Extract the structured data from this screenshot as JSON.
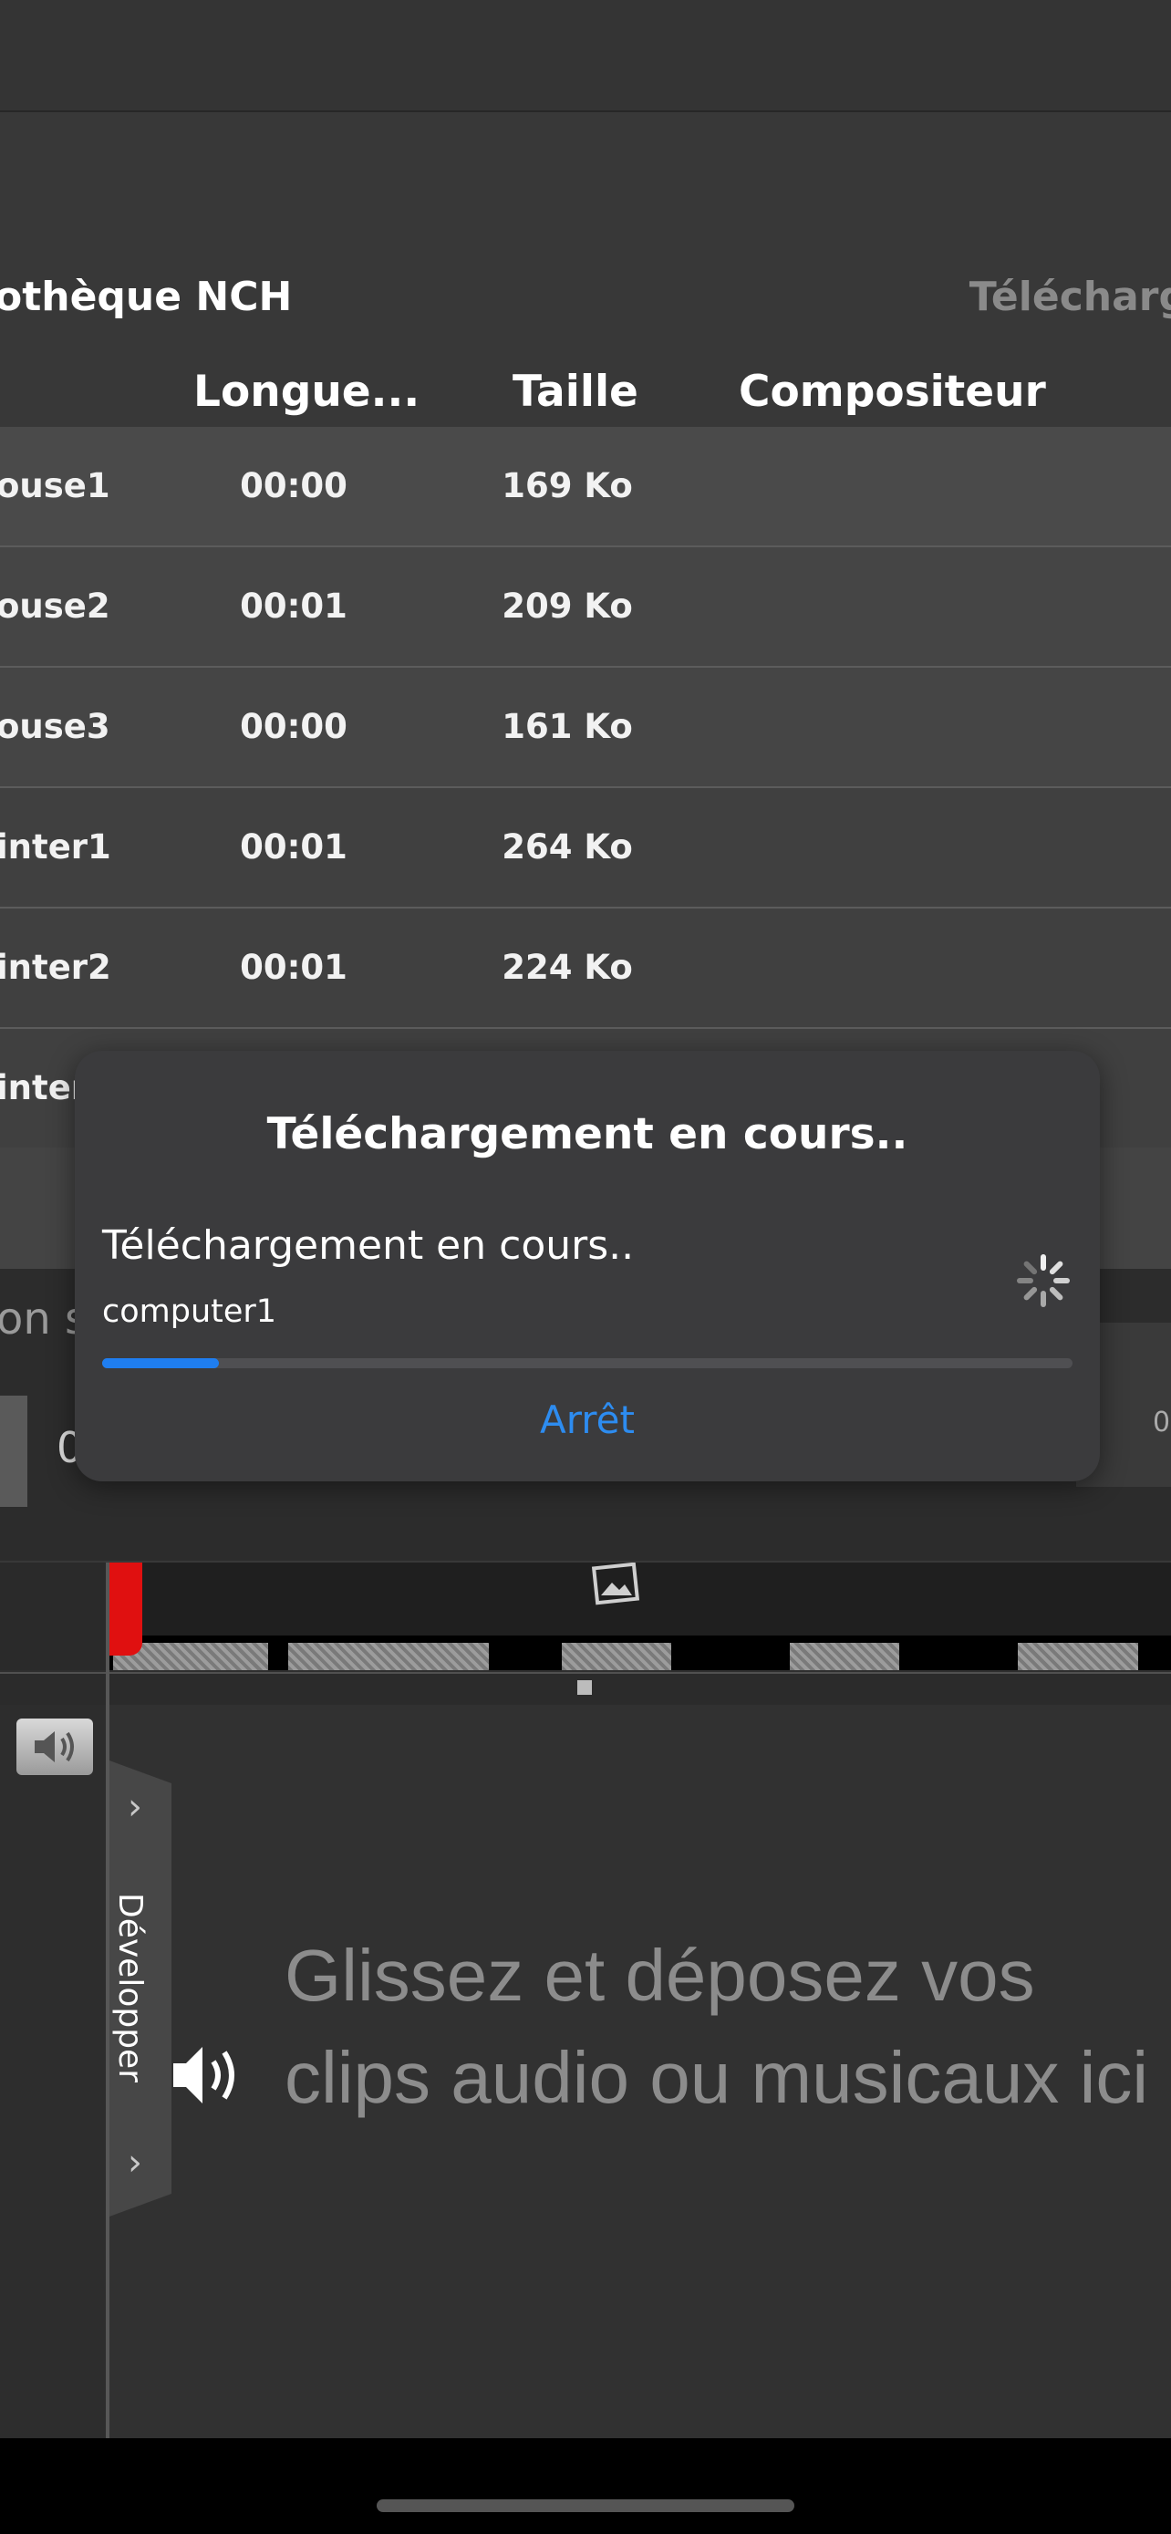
{
  "library": {
    "title": "othèque NCH",
    "download_label": "Télécharg",
    "columns": [
      "Longue...",
      "Taille",
      "Compositeur"
    ],
    "rows": [
      {
        "name": "ouse1",
        "length": "00:00",
        "size": "169 Ko",
        "composer": ""
      },
      {
        "name": "ouse2",
        "length": "00:01",
        "size": "209 Ko",
        "composer": ""
      },
      {
        "name": "ouse3",
        "length": "00:00",
        "size": "161 Ko",
        "composer": ""
      },
      {
        "name": "inter1",
        "length": "00:01",
        "size": "264 Ko",
        "composer": ""
      },
      {
        "name": "inter2",
        "length": "00:01",
        "size": "224 Ko",
        "composer": ""
      },
      {
        "name": "inter",
        "length": "",
        "size": "",
        "composer": ""
      }
    ]
  },
  "background": {
    "partial_text": "on sc",
    "partial_zero": "0",
    "partial_right_zero": "0"
  },
  "audio": {
    "develop_label": "Développer",
    "drop_text": "Glissez et déposez vos clips audio ou musicaux ici"
  },
  "dialog": {
    "title": "Téléchargement en cours..",
    "message": "Téléchargement en cours..",
    "file": "computer1",
    "progress": 0.12,
    "stop_label": "Arrêt"
  },
  "colors": {
    "accent": "#1f7ef0",
    "stop": "#2d8cf0"
  }
}
